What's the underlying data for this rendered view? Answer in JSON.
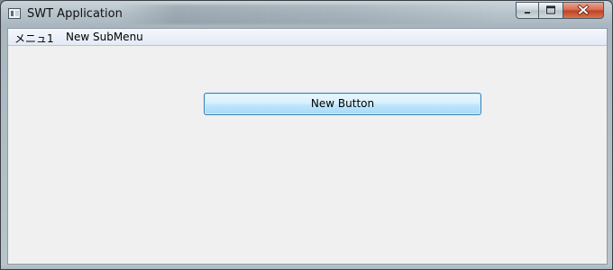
{
  "window": {
    "title": "SWT Application"
  },
  "menubar": {
    "items": [
      {
        "label": "メニュ1"
      },
      {
        "label": "New SubMenu"
      }
    ]
  },
  "content": {
    "button_label": "New Button"
  },
  "icons": {
    "app": "window-icon",
    "minimize": "minimize-icon",
    "maximize": "maximize-icon",
    "close": "close-icon"
  }
}
